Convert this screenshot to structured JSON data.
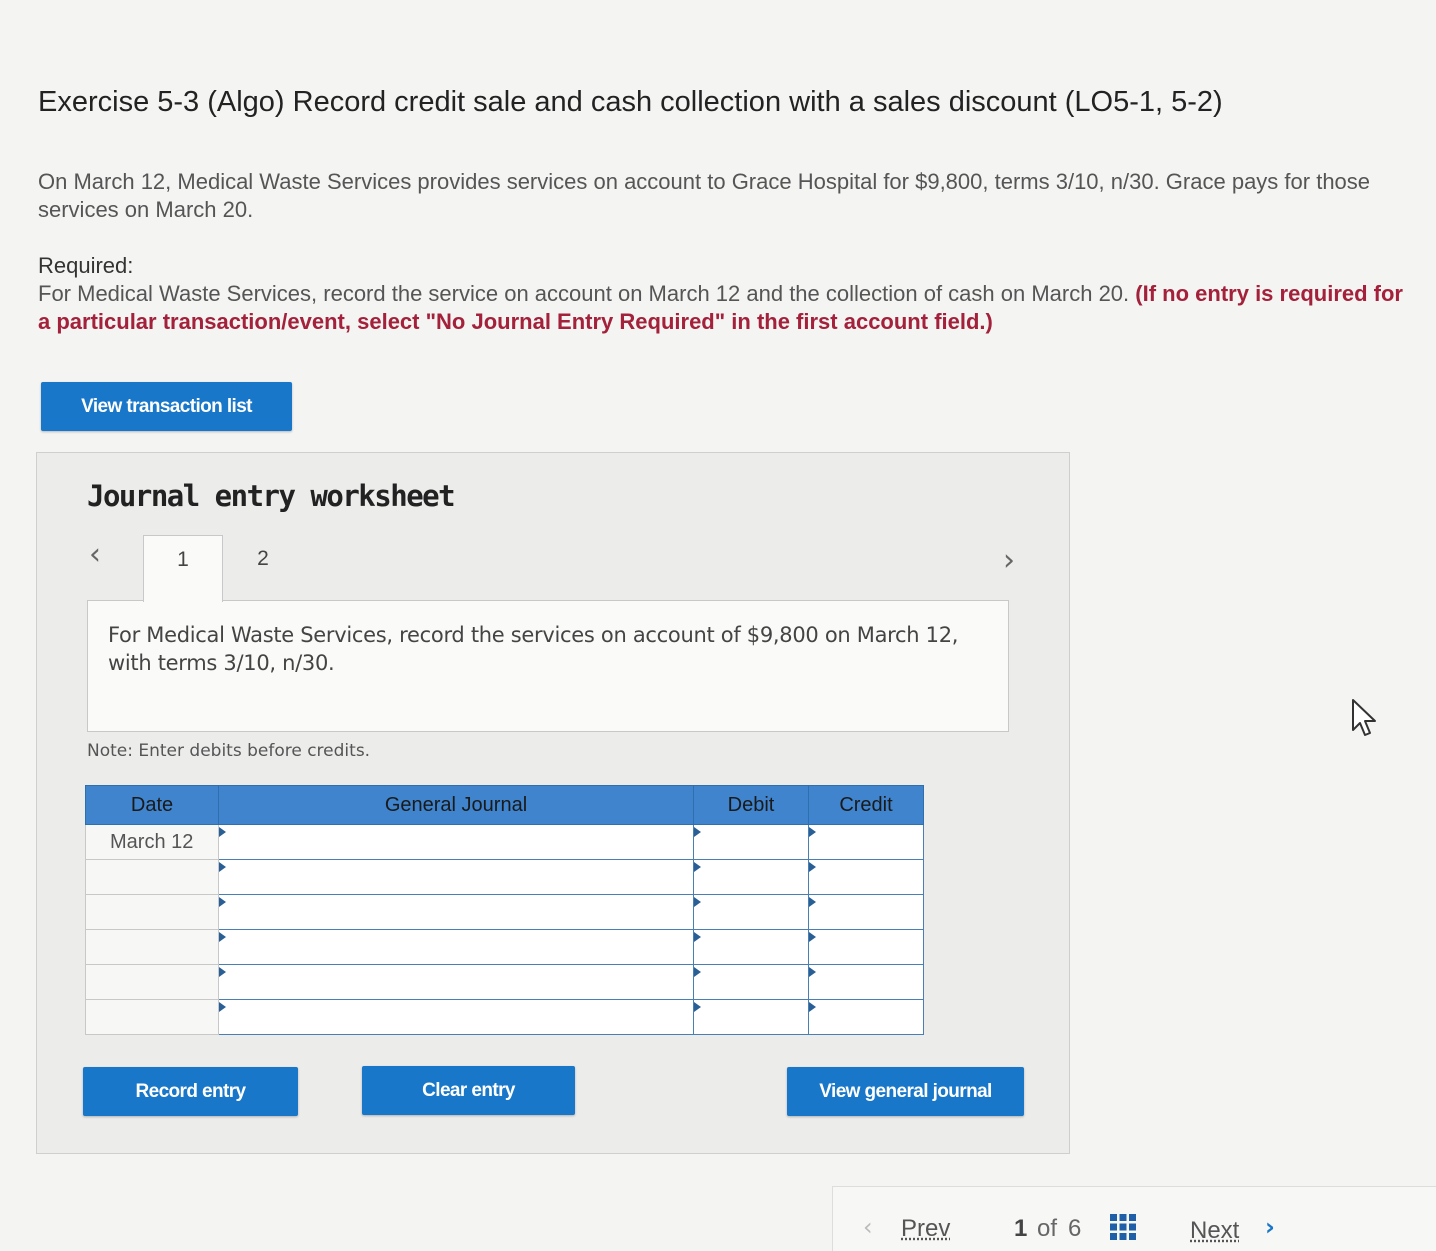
{
  "title": "Exercise 5-3 (Algo) Record credit sale and cash collection with a sales discount (LO5-1, 5-2)",
  "prompt": "On March 12, Medical Waste Services provides services on account to Grace Hospital for $9,800, terms 3/10, n/30. Grace pays for those services on March 20.",
  "required": {
    "label": "Required:",
    "text": "For Medical Waste Services, record the service on account on March 12 and the collection of cash on March 20.",
    "emphasis": "(If no entry is required for a particular transaction/event, select \"No Journal Entry Required\" in the first account field.)"
  },
  "view_transaction_list": "View transaction list",
  "worksheet": {
    "title": "Journal entry worksheet",
    "tabs": [
      "1",
      "2"
    ],
    "active_tab": "1",
    "instruction": "For Medical Waste Services, record the services on account of $9,800 on March 12, with terms 3/10, n/30.",
    "note": "Note: Enter debits before credits.",
    "columns": {
      "date": "Date",
      "general_journal": "General Journal",
      "debit": "Debit",
      "credit": "Credit"
    },
    "rows": [
      {
        "date": "March 12",
        "account": "",
        "debit": "",
        "credit": ""
      },
      {
        "date": "",
        "account": "",
        "debit": "",
        "credit": ""
      },
      {
        "date": "",
        "account": "",
        "debit": "",
        "credit": ""
      },
      {
        "date": "",
        "account": "",
        "debit": "",
        "credit": ""
      },
      {
        "date": "",
        "account": "",
        "debit": "",
        "credit": ""
      },
      {
        "date": "",
        "account": "",
        "debit": "",
        "credit": ""
      }
    ],
    "buttons": {
      "record": "Record entry",
      "clear": "Clear entry",
      "view_general_journal": "View general journal"
    }
  },
  "pager": {
    "prev": "Prev",
    "current": "1",
    "of": "of",
    "total": "6",
    "next": "Next"
  },
  "colors": {
    "accent": "#1877c9",
    "emphasis": "#a3213a",
    "table_header": "#3f84cc"
  }
}
